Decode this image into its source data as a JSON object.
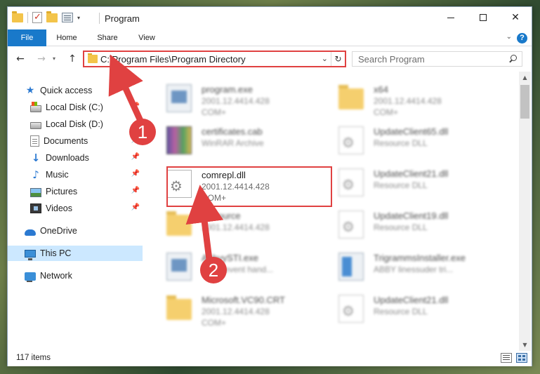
{
  "window": {
    "title": "Program",
    "controls": {
      "minimize": "minimize",
      "maximize": "maximize",
      "close": "✕"
    }
  },
  "ribbon": {
    "tabs": [
      "File",
      "Home",
      "Share",
      "View"
    ],
    "help": "?"
  },
  "navigation": {
    "back": "←",
    "forward": "→",
    "recent": "▾",
    "up": "↑",
    "address": "C:\\Program Files\\Program Directory",
    "search_placeholder": "Search Program"
  },
  "nav_pane": {
    "items": [
      {
        "label": "Quick access",
        "icon": "star-icon"
      },
      {
        "label": "Local Disk (C:)",
        "icon": "disk-icon",
        "pinned": true
      },
      {
        "label": "Local Disk (D:)",
        "icon": "disk-icon"
      },
      {
        "label": "Documents",
        "icon": "documents-icon",
        "pinned": true
      },
      {
        "label": "Downloads",
        "icon": "download-icon",
        "pinned": true
      },
      {
        "label": "Music",
        "icon": "music-icon",
        "pinned": true
      },
      {
        "label": "Pictures",
        "icon": "pictures-icon",
        "pinned": true
      },
      {
        "label": "Videos",
        "icon": "videos-icon",
        "pinned": true
      },
      {
        "label": "OneDrive",
        "icon": "cloud-icon"
      },
      {
        "label": "This PC",
        "icon": "computer-icon",
        "selected": true
      },
      {
        "label": "Network",
        "icon": "network-icon"
      }
    ]
  },
  "files": [
    {
      "name": "program.exe",
      "line2": "2001.12.4414.428",
      "line3": "COM+",
      "icon": "exe-icon",
      "blurred": true
    },
    {
      "name": "x64",
      "line2": "2001.12.4414.428",
      "line3": "COM+",
      "icon": "folder-icon",
      "blurred": true
    },
    {
      "name": "certificates.cab",
      "line2": "WinRAR Archive",
      "line3": "",
      "icon": "archive-icon",
      "blurred": true
    },
    {
      "name": "UpdateClient65.dll",
      "line2": "Resource DLL",
      "line3": "",
      "icon": "dll-icon",
      "blurred": true
    },
    {
      "name": "comrepl.dll",
      "line2": "2001.12.4414.428",
      "line3": "COM+",
      "icon": "dll-icon",
      "blurred": false
    },
    {
      "name": "UpdateClient21.dll",
      "line2": "Resource DLL",
      "line3": "",
      "icon": "dll-icon",
      "blurred": true
    },
    {
      "name": "Resource",
      "line2": "2001.12.4414.428",
      "line3": "",
      "icon": "folder-icon",
      "blurred": true
    },
    {
      "name": "UpdateClient19.dll",
      "line2": "Resource DLL",
      "line3": "",
      "icon": "dll-icon",
      "blurred": true
    },
    {
      "name": "AbbyySTI.exe",
      "line2": "ab so event hand...",
      "line3": "",
      "icon": "exe-icon",
      "blurred": true
    },
    {
      "name": "TrigrammsInstaller.exe",
      "line2": "ABBY linessuder tri...",
      "line3": "",
      "icon": "setup-icon",
      "blurred": true
    },
    {
      "name": "Microsoft.VC90.CRT",
      "line2": "2001.12.4414.428",
      "line3": "COM+",
      "icon": "folder-icon",
      "blurred": true
    },
    {
      "name": "UpdateClient21.dll",
      "line2": "Resource DLL",
      "line3": "",
      "icon": "dll-icon",
      "blurred": true
    }
  ],
  "status": {
    "item_count": "117 items"
  },
  "annotations": {
    "callout_1": "1",
    "callout_2": "2",
    "color": "#e04141"
  }
}
